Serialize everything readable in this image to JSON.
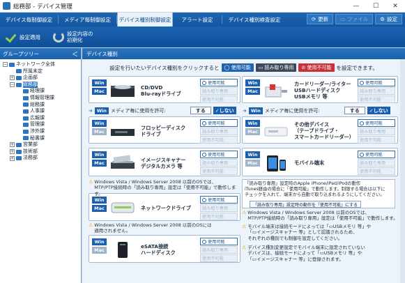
{
  "window": {
    "title": "総務部 - デバイス管理",
    "minimize": "—",
    "maximize": "☐",
    "close": "✕"
  },
  "tabs": [
    {
      "label": "デバイス毎制御設定",
      "state": "normal"
    },
    {
      "label": "メディア毎制御設定",
      "state": "normal"
    },
    {
      "label": "デバイス種別制御設定",
      "state": "active"
    },
    {
      "label": "アラート設定",
      "state": "normal"
    },
    {
      "label": "デバイス種別検査設定",
      "state": "normal"
    }
  ],
  "right_buttons": [
    {
      "label": "更新",
      "icon": "refresh-icon",
      "state": "normal"
    },
    {
      "label": "ファイル",
      "icon": "file-icon",
      "state": "disabled"
    },
    {
      "label": "設定",
      "icon": "gear-icon",
      "state": "normal"
    }
  ],
  "toolbar": {
    "apply_label": "設定適用",
    "reset_label_1": "設定内容の",
    "reset_label_2": "初期化"
  },
  "sidebar": {
    "title": "グループツリー",
    "collapse": "＜",
    "nodes": [
      {
        "label": "ネットワーク全体",
        "depth": 0,
        "toggle": "−",
        "selected": false
      },
      {
        "label": "所属未定",
        "depth": 1,
        "toggle": "",
        "selected": false
      },
      {
        "label": "企画部",
        "depth": 1,
        "toggle": "+",
        "selected": false
      },
      {
        "label": "総務部",
        "depth": 1,
        "toggle": "−",
        "selected": true
      },
      {
        "label": "経理課",
        "depth": 2,
        "toggle": "",
        "selected": false
      },
      {
        "label": "情報管理課",
        "depth": 2,
        "toggle": "",
        "selected": false
      },
      {
        "label": "総務課",
        "depth": 2,
        "toggle": "",
        "selected": false
      },
      {
        "label": "人事課",
        "depth": 2,
        "toggle": "",
        "selected": false
      },
      {
        "label": "広報課",
        "depth": 2,
        "toggle": "",
        "selected": false
      },
      {
        "label": "管理課",
        "depth": 2,
        "toggle": "",
        "selected": false
      },
      {
        "label": "渉外課",
        "depth": 2,
        "toggle": "",
        "selected": false
      },
      {
        "label": "秘書課",
        "depth": 2,
        "toggle": "",
        "selected": false
      },
      {
        "label": "営業部",
        "depth": 1,
        "toggle": "+",
        "selected": false
      },
      {
        "label": "技術部",
        "depth": 1,
        "toggle": "+",
        "selected": false
      },
      {
        "label": "法務部",
        "depth": 1,
        "toggle": "+",
        "selected": false
      }
    ]
  },
  "main": {
    "title": "デバイス種別",
    "instruction_pre": "設定を行いたいデバイス種別をクリックすると",
    "instruction_post": "を設定できます。",
    "legend": {
      "usable": "使用可能",
      "readonly": "読み取り専用",
      "unusable": "使用不可能"
    },
    "option_labels": {
      "usable": "使用可能",
      "readonly": "読み取り専用",
      "unusable": "使用不可能"
    },
    "allow": {
      "win": "Win",
      "text": "メディア毎に使用を許可:",
      "yes": "する",
      "no": "しない"
    },
    "badges": {
      "win": "Win",
      "mac": "Mac"
    },
    "devices": [
      {
        "id": "cd",
        "line1": "CD/DVD",
        "line2": "Blu-rayドライブ",
        "line3": ""
      },
      {
        "id": "card",
        "line1": "カードリーダー/ライター",
        "line2": "USBハードディスク",
        "line3": "USBメモリ 等"
      },
      {
        "id": "floppy",
        "line1": "フロッピーディスク",
        "line2": "ドライブ",
        "line3": ""
      },
      {
        "id": "other",
        "line1": "その他デバイス",
        "line2": "（テープドライブ・",
        "line3": "スマートカードリーダー）"
      },
      {
        "id": "scanner",
        "line1": "イメージスキャナー",
        "line2": "デジタルカメラ 等",
        "line3": ""
      },
      {
        "id": "mobile",
        "line1": "モバイル端末",
        "line2": "",
        "line3": ""
      },
      {
        "id": "network",
        "line1": "ネットワークドライブ",
        "line2": "",
        "line3": ""
      },
      {
        "id": "esata",
        "line1": "eSATA接続",
        "line2": "ハードディスク",
        "line3": ""
      }
    ],
    "notes": {
      "scanner_1": "Windows Vista / Windows Server 2008 以前のOSでは、",
      "scanner_2": "MTP/PTP接続時の「読み取り専用」設定は「使用不可能」で動作します。",
      "network_1": "Windows Vista / Windows Server 2008 以前のOSには",
      "network_2": "適用されません。",
      "info_1": "「読み取り専用」設定時のApple iPhone/iPad/iPodの動作",
      "info_2": "iTunes経由の場合に「使用可能」で動作します。制限する場合は以下に",
      "info_3": "チェックを入れて、端末から自動で取り込まれるようにしてください。",
      "info_btn": "「読み取り専用」設定時の動作を「使用不可能」にする",
      "right_1": "Windows Vista / Windows Server 2008 以前のOSでは、",
      "right_2": "MTP/PTP接続時の「読み取り専用」設定は「使用不可能」で動作します。",
      "right_3": "モバイル端末は接続モードによっては「",
      "right_3b": "USBメモリ 等」や",
      "right_4": "「",
      "right_4b": "イメージスキャナー 等」として認識されるため、",
      "right_5": "それぞれの種別でも制御を設定してください。",
      "right_6": "デバイス種別変更設定でモバイル端末に設定されていない",
      "right_7": "デバイスは、接続モードによって「",
      "right_7b": "USBメモリ 等」や",
      "right_8": "「",
      "right_8b": "イメージスキャナー 等」に登録されます。"
    }
  }
}
